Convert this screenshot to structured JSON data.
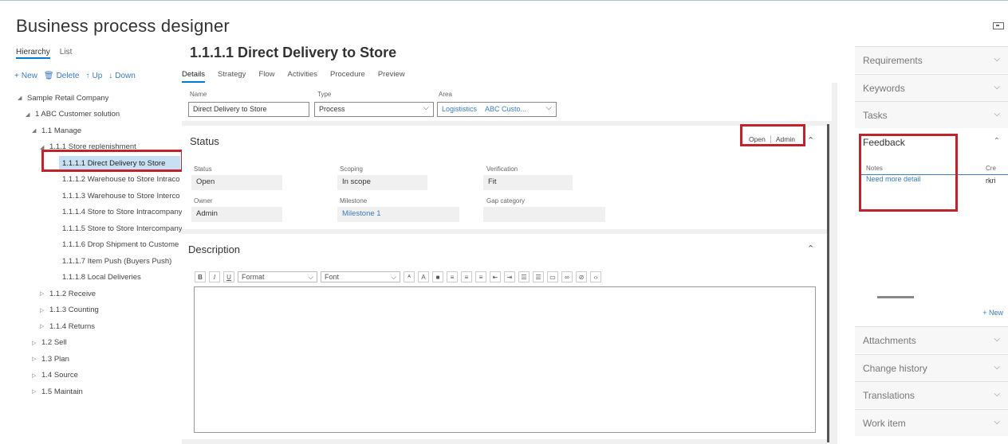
{
  "app": {
    "title": "Business process designer"
  },
  "left": {
    "view_tabs": [
      "Hierarchy",
      "List"
    ],
    "toolbar": [
      {
        "icon": "plus-icon",
        "glyph": "+",
        "label": "New"
      },
      {
        "icon": "trash-icon",
        "glyph": "🗑",
        "label": "Delete"
      },
      {
        "icon": "arrow-up-icon",
        "glyph": "↑",
        "label": "Up"
      },
      {
        "icon": "arrow-down-icon",
        "glyph": "↓",
        "label": "Down"
      }
    ],
    "tree": [
      {
        "label": "Sample Retail Company",
        "chev": "◢"
      },
      {
        "label": "1 ABC Customer solution",
        "chev": "◢"
      },
      {
        "label": "1.1 Manage",
        "chev": "◢"
      },
      {
        "label": "1.1.1 Store replenishment",
        "chev": "◢"
      },
      {
        "label": "1.1.1.1 Direct Delivery to Store",
        "chev": ""
      },
      {
        "label": "1.1.1.2 Warehouse to Store Intraco",
        "chev": ""
      },
      {
        "label": "1.1.1.3 Warehouse to Store Interco",
        "chev": ""
      },
      {
        "label": "1.1.1.4 Store to Store Intracompany",
        "chev": ""
      },
      {
        "label": "1.1.1.5 Store to Store Intercompany",
        "chev": ""
      },
      {
        "label": "1.1.1.6 Drop Shipment to Custome",
        "chev": ""
      },
      {
        "label": "1.1.1.7 Item Push (Buyers Push)",
        "chev": ""
      },
      {
        "label": "1.1.1.8 Local Deliveries",
        "chev": ""
      },
      {
        "label": "1.1.2 Receive",
        "chev": "▷"
      },
      {
        "label": "1.1.3 Counting",
        "chev": "▷"
      },
      {
        "label": "1.1.4 Returns",
        "chev": "▷"
      },
      {
        "label": "1.2 Sell",
        "chev": "▷"
      },
      {
        "label": "1.3 Plan",
        "chev": "▷"
      },
      {
        "label": "1.4 Source",
        "chev": "▷"
      },
      {
        "label": "1.5 Maintain",
        "chev": "▷"
      }
    ],
    "selected": "1.1.1.1 Direct Delivery to Store"
  },
  "record": {
    "title": "1.1.1.1 Direct Delivery to Store",
    "tabs": [
      "Details",
      "Strategy",
      "Flow",
      "Activities",
      "Procedure",
      "Preview"
    ],
    "fields": {
      "name_label": "Name",
      "name_value": "Direct Delivery to Store",
      "type_label": "Type",
      "type_value": "Process",
      "area_label": "Area",
      "area_value_a": "Logististics",
      "area_value_b": "ABC Custo..."
    },
    "status_card": {
      "title": "Status",
      "open_btn": "Open",
      "admin_btn": "Admin",
      "status_label": "Status",
      "status_value": "Open",
      "scoping_label": "Scoping",
      "scoping_value": "In scope",
      "verification_label": "Verification",
      "verification_value": "Fit",
      "owner_label": "Owner",
      "owner_value": "Admin",
      "milestone_label": "Milestone",
      "milestone_value": "Milestone 1",
      "gap_label": "Gap category",
      "gap_value": ""
    },
    "description_card": {
      "title": "Description",
      "format_label": "Format",
      "font_label": "Font"
    }
  },
  "right": {
    "sections_top": [
      "Requirements",
      "Keywords",
      "Tasks"
    ],
    "feedback": {
      "title": "Feedback",
      "col_notes": "Notes",
      "col_created": "Cre",
      "note": "Need more detail",
      "user": "rkri",
      "new_label": "New"
    },
    "sections_bottom": [
      "Attachments",
      "Change history",
      "Translations",
      "Work item"
    ]
  },
  "colors": {
    "accent": "#0078d4",
    "highlight": "#c0232b",
    "link": "#3a7bbf"
  }
}
